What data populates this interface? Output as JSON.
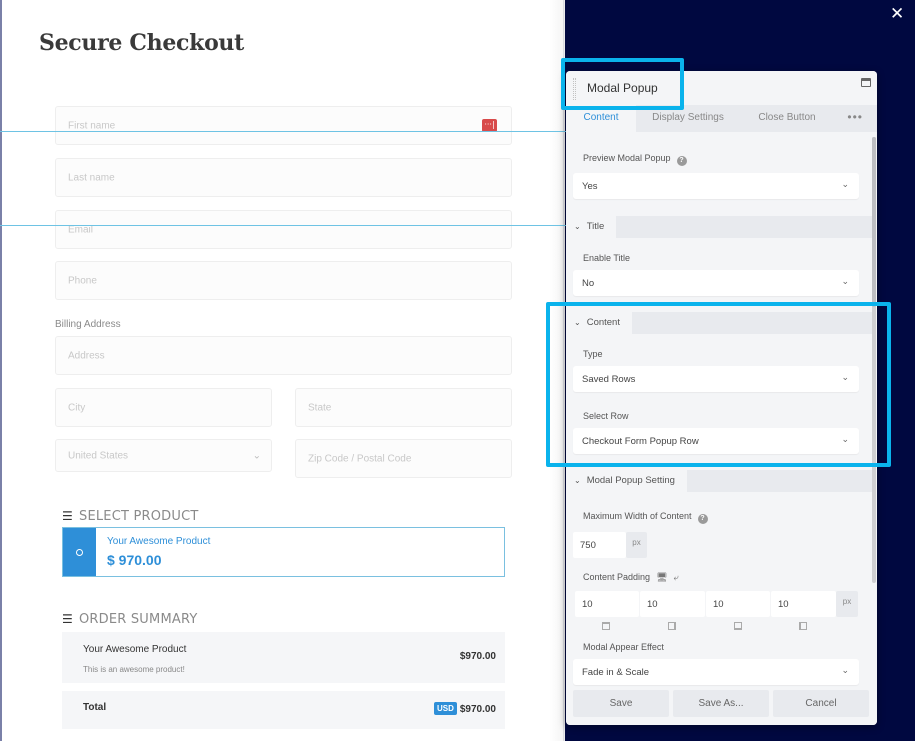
{
  "checkout": {
    "title": "Secure Checkout",
    "fields": {
      "first_name": "First name",
      "last_name": "Last name",
      "email": "Email",
      "phone": "Phone",
      "billing_label": "Billing Address",
      "address": "Address",
      "city": "City",
      "state": "State",
      "country": "United States",
      "zip": "Zip Code / Postal Code"
    },
    "password_manager_icon": "···|",
    "select_product": {
      "heading": "SELECT PRODUCT",
      "product_name": "Your Awesome Product",
      "product_price": "$ 970.00",
      "selected": true
    },
    "order_summary": {
      "heading": "ORDER SUMMARY",
      "item_name": "Your Awesome Product",
      "item_desc": "This is an awesome product!",
      "item_price": "$970.00",
      "total_label": "Total",
      "currency_badge": "USD",
      "total_price": "$970.00"
    }
  },
  "overlay": {
    "close_icon": "✕"
  },
  "panel": {
    "title": "Modal Popup",
    "tabs": [
      {
        "label": "Content",
        "active": true
      },
      {
        "label": "Display Settings",
        "active": false
      },
      {
        "label": "Close Button",
        "active": false
      }
    ],
    "more_label": "•••",
    "preview": {
      "label": "Preview Modal Popup",
      "value": "Yes"
    },
    "sections": {
      "title": {
        "heading": "Title",
        "enable_title_label": "Enable Title",
        "enable_title_value": "No"
      },
      "content": {
        "heading": "Content",
        "type_label": "Type",
        "type_value": "Saved Rows",
        "select_row_label": "Select Row",
        "select_row_value": "Checkout Form Popup Row"
      },
      "modal_setting": {
        "heading": "Modal Popup Setting",
        "max_width_label": "Maximum Width of Content",
        "max_width_value": "750",
        "max_width_unit": "px",
        "padding_label": "Content Padding",
        "padding_values": [
          "10",
          "10",
          "10",
          "10"
        ],
        "padding_unit": "px",
        "appear_effect_label": "Modal Appear Effect",
        "appear_effect_value": "Fade in & Scale"
      }
    },
    "footer": {
      "save": "Save",
      "save_as": "Save As...",
      "cancel": "Cancel"
    }
  },
  "colors": {
    "accent": "#2e8fd8",
    "highlight": "#0ab3ec",
    "backdrop": "#000840",
    "alert": "#d84a4a"
  }
}
